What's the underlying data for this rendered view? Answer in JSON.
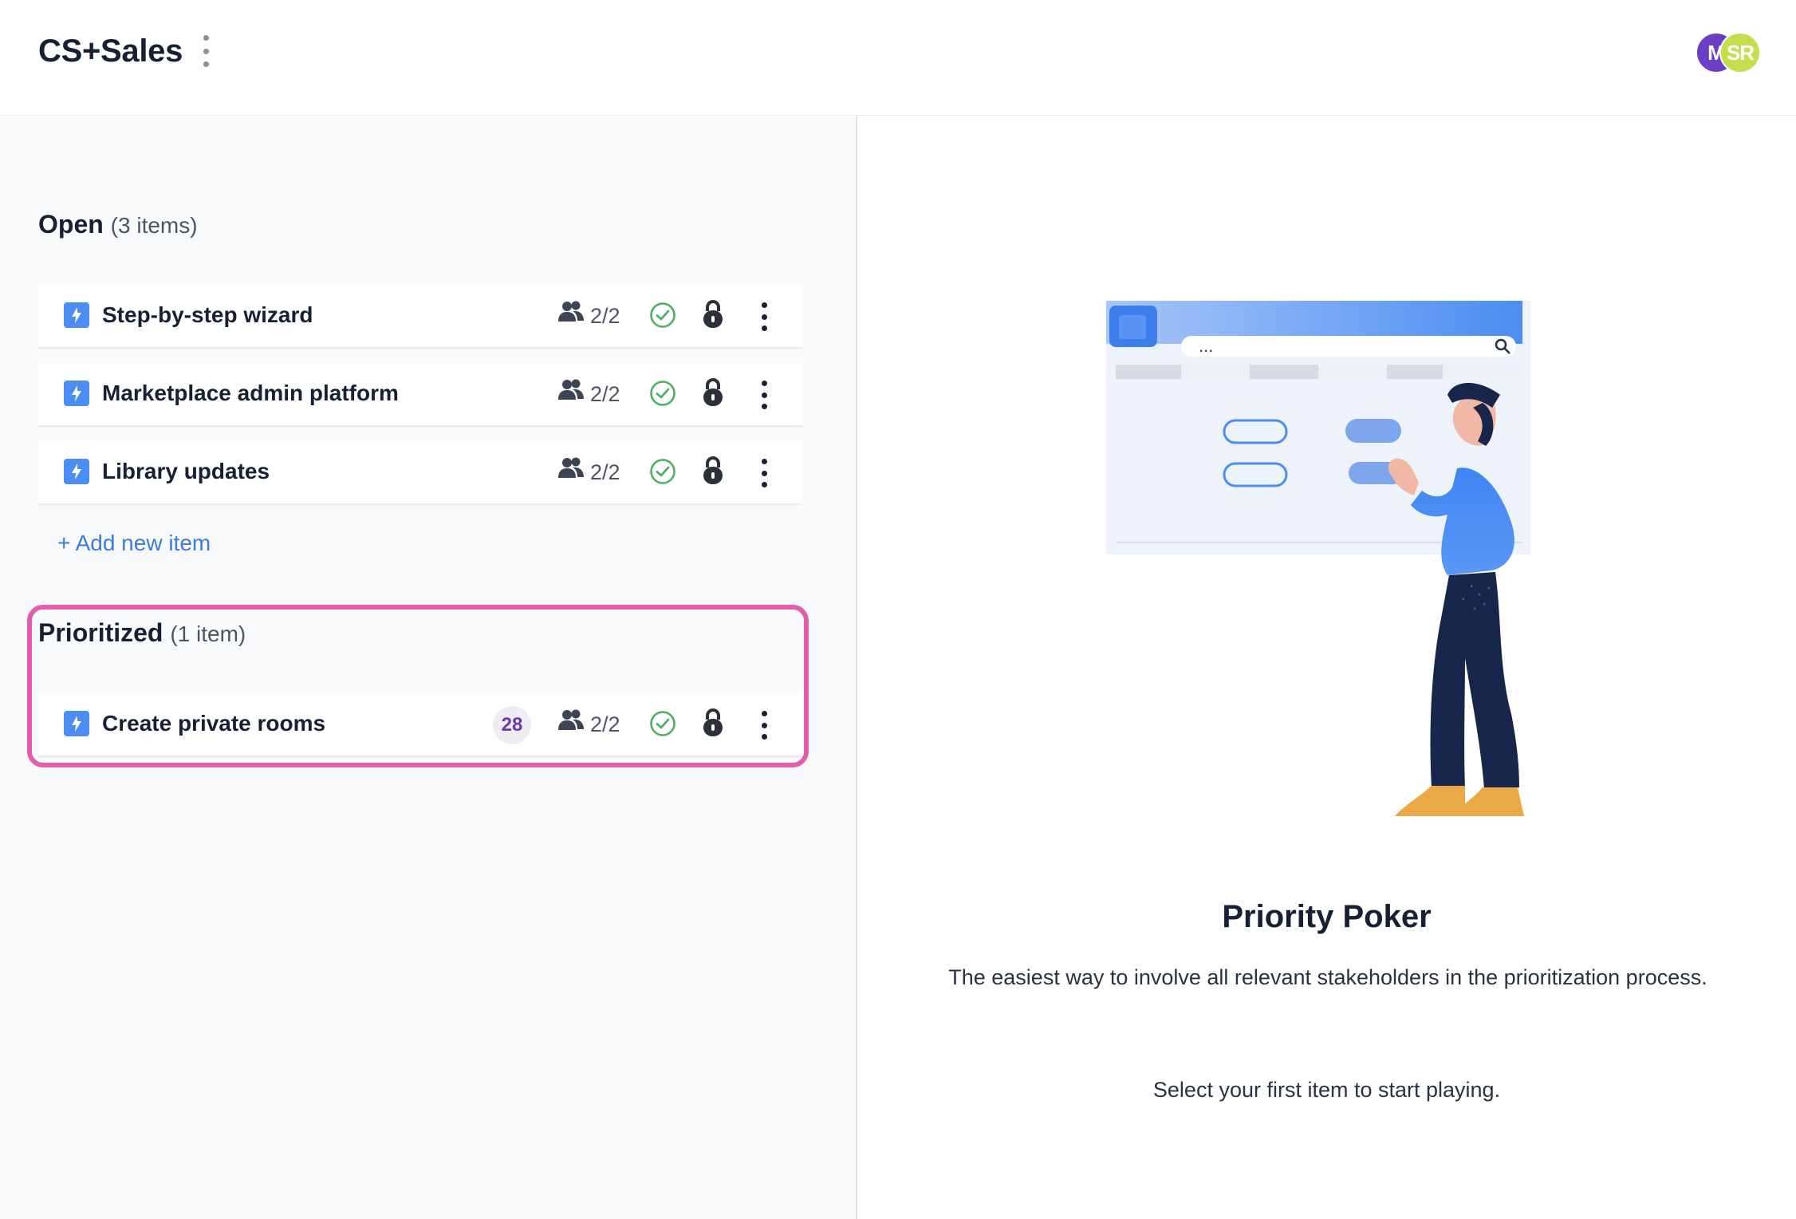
{
  "header": {
    "board_title": "CS+Sales",
    "avatars": [
      {
        "initials": "M",
        "color": "#6b3fc3"
      },
      {
        "initials": "SR",
        "color": "#c6dd4c"
      }
    ]
  },
  "open_section": {
    "title": "Open",
    "count": "(3 items)",
    "items": [
      {
        "label": "Step-by-step wizard",
        "voters": "2/2"
      },
      {
        "label": "Marketplace admin platform",
        "voters": "2/2"
      },
      {
        "label": "Library updates",
        "voters": "2/2"
      }
    ],
    "add_label": "+ Add new item"
  },
  "prioritized_section": {
    "title": "Prioritized",
    "count": "(1 item)",
    "items": [
      {
        "label": "Create private rooms",
        "score": "28",
        "voters": "2/2"
      }
    ]
  },
  "info_panel": {
    "title": "Priority Poker",
    "description": "The easiest way to involve all relevant stakeholders in the prioritization process.",
    "cta": "Select your first item to start playing.",
    "illustration_dots": "..."
  },
  "colors": {
    "accent": "#3c7be0",
    "highlight": "#e25eaa",
    "score_text": "#6a3ba8",
    "check": "#4caf63"
  },
  "icons": [
    "kebab-menu-icon",
    "lightning-icon",
    "voters-icon",
    "check-circle-icon",
    "lock-icon"
  ]
}
